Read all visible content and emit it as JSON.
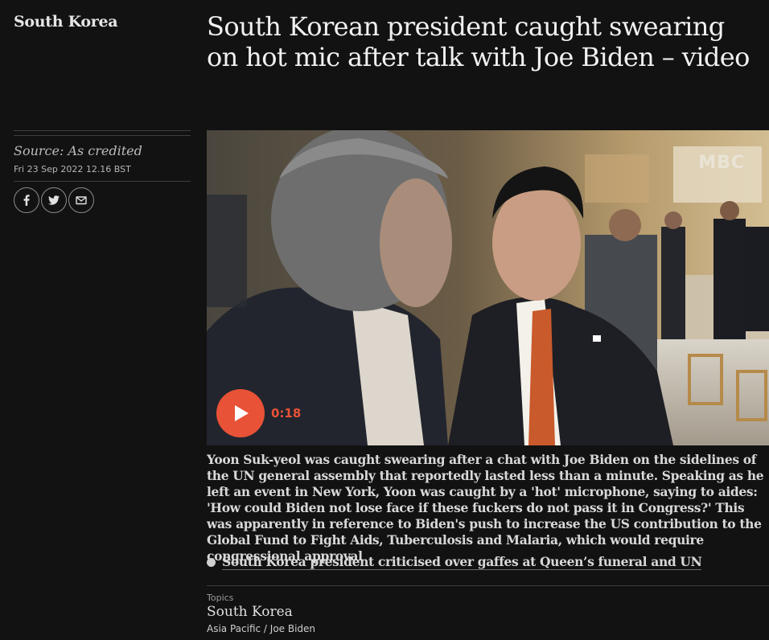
{
  "section": {
    "label": "South Korea"
  },
  "headline": "South Korean president caught swearing on hot mic after talk with Joe Biden – video",
  "meta": {
    "source": "Source: As credited",
    "date": "Fri 23 Sep 2022 12.16 BST"
  },
  "share": {
    "icons": [
      "facebook-icon",
      "twitter-icon",
      "email-icon"
    ]
  },
  "video": {
    "watermark": "MBC",
    "duration": "0:18",
    "accent": "#e85236"
  },
  "caption": "Yoon Suk-yeol was caught swearing after a chat with Joe Biden on the sidelines of the UN general assembly that reportedly lasted less than a minute. Speaking as he left an event in New York, Yoon was caught by a 'hot' microphone, saying to aides: 'How could Biden not lose face if these fuckers do not pass it in Congress?' This was apparently in reference to Biden's push to increase the US contribution to the Global Fund to Fight Aids, Tuberculosis and Malaria, which would require congressional approval",
  "related": {
    "link": "South Korea president criticised over gaffes at Queen’s funeral and UN"
  },
  "topics": {
    "label": "Topics",
    "primary": "South Korea",
    "secondary": [
      "Asia Pacific",
      "Joe Biden"
    ],
    "separator": " / "
  }
}
